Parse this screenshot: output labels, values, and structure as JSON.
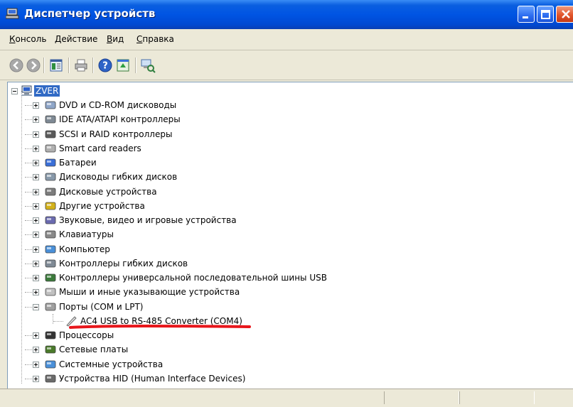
{
  "window": {
    "title": "Диспетчер устройств"
  },
  "menu": {
    "items": [
      {
        "label": "Консоль",
        "accel": "К",
        "rest": "онсоль"
      },
      {
        "label": "Действие",
        "accel": "Д",
        "rest": "ействие"
      },
      {
        "label": "Вид",
        "accel": "В",
        "rest": "ид"
      },
      {
        "label": "Справка",
        "accel": "С",
        "rest": "правка"
      }
    ]
  },
  "toolbar": {
    "buttons": [
      "back-icon",
      "forward-icon",
      "properties-icon",
      "print-icon",
      "help-icon",
      "update-icon",
      "scan-hardware-icon"
    ]
  },
  "tree": {
    "root": "ZVER",
    "categories": [
      "DVD и CD-ROM дисководы",
      "IDE ATA/ATAPI контроллеры",
      "SCSI и RAID контроллеры",
      "Smart card readers",
      "Батареи",
      "Дисководы гибких дисков",
      "Дисковые устройства",
      "Другие устройства",
      "Звуковые, видео и игровые устройства",
      "Клавиатуры",
      "Компьютер",
      "Контроллеры гибких дисков",
      "Контроллеры универсальной последовательной шины USB",
      "Мыши и иные указывающие устройства",
      "Порты (COM и LPT)",
      "Процессоры",
      "Сетевые платы",
      "Системные устройства",
      "Устройства HID (Human Interface Devices)"
    ],
    "expanded_child": "AC4 USB to RS-485 Converter (COM4)"
  },
  "colors": {
    "titlebar": "#0054e3",
    "selection": "#316ac5",
    "annotation": "#e8161b"
  }
}
